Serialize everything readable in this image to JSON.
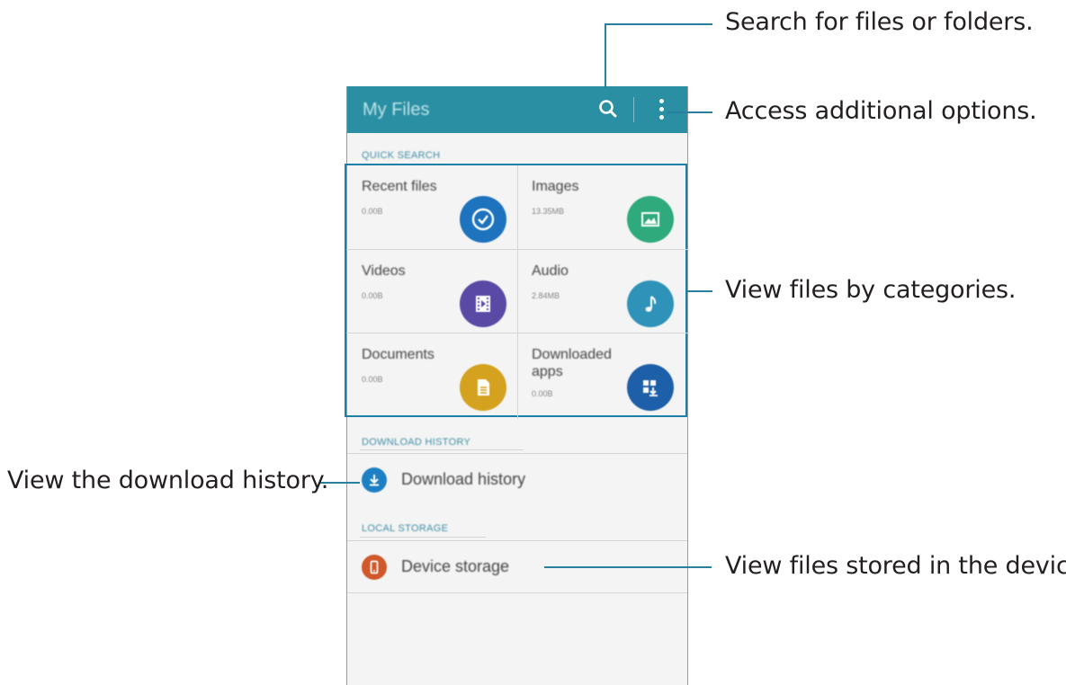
{
  "callouts": {
    "search": "Search for files or folders.",
    "options": "Access additional options.",
    "categories": "View files by categories.",
    "download_history": "View the download history.",
    "device": "View files stored in the device."
  },
  "app": {
    "title": "My Files",
    "search_icon": "search-icon",
    "more_icon": "more-vert-icon",
    "accent": "#2a8fa3"
  },
  "quick_search": {
    "header": "QUICK SEARCH",
    "categories": [
      {
        "name": "Recent files",
        "size": "0.00B",
        "icon": "clock-icon",
        "color": "#1e73be"
      },
      {
        "name": "Images",
        "size": "13.35MB",
        "icon": "image-icon",
        "color": "#2eaa7d"
      },
      {
        "name": "Videos",
        "size": "0.00B",
        "icon": "film-icon",
        "color": "#5a4aa5"
      },
      {
        "name": "Audio",
        "size": "2.84MB",
        "icon": "music-note-icon",
        "color": "#2f93b9"
      },
      {
        "name": "Documents",
        "size": "0.00B",
        "icon": "document-icon",
        "color": "#d4a21e"
      },
      {
        "name": "Downloaded apps",
        "size": "0.00B",
        "icon": "apps-download-icon",
        "color": "#1d5fa8"
      }
    ]
  },
  "download_history": {
    "header": "DOWNLOAD HISTORY",
    "item": "Download history",
    "icon_color": "#1e80c4"
  },
  "local_storage": {
    "header": "LOCAL STORAGE",
    "item": "Device storage",
    "icon_color": "#d0582a"
  }
}
